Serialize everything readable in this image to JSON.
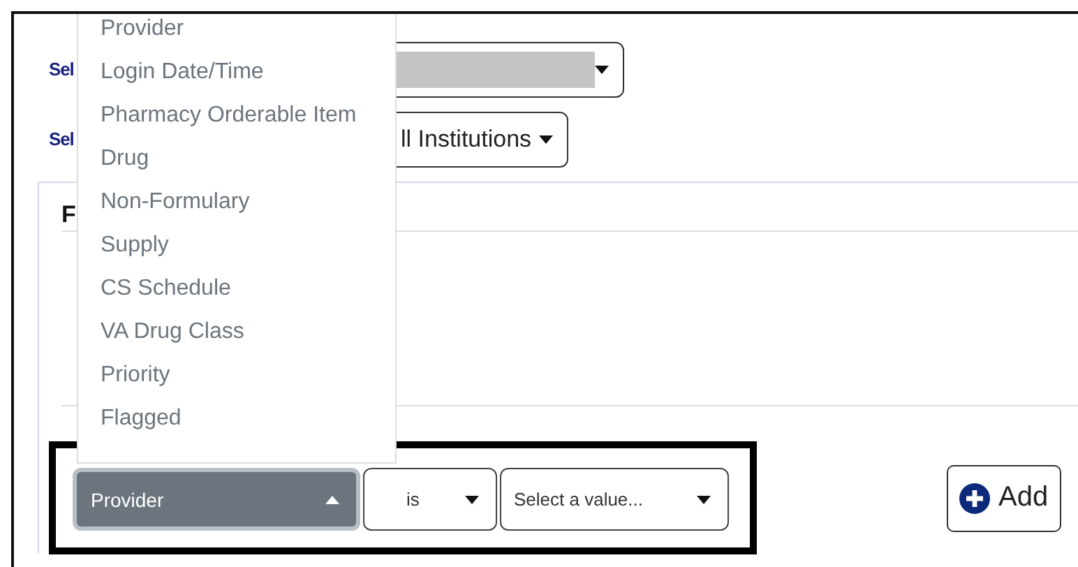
{
  "filters_form": {
    "rows": [
      {
        "label": "Sel",
        "select": {
          "redacted": true
        }
      },
      {
        "label": "Sel",
        "select": {
          "value": "ll Institutions"
        }
      }
    ]
  },
  "panel": {
    "heading": "F",
    "criteria_row": {
      "field_select": {
        "value": "Provider",
        "expanded": true
      },
      "operator_select": {
        "value": "is"
      },
      "value_select": {
        "placeholder": "Select a value..."
      }
    },
    "add_button": {
      "label": "Add"
    }
  },
  "field_menu": {
    "items": [
      {
        "label": "Provider"
      },
      {
        "label": "Login Date/Time"
      },
      {
        "label": "Pharmacy Orderable Item"
      },
      {
        "label": "Drug"
      },
      {
        "label": "Non-Formulary"
      },
      {
        "label": "Supply"
      },
      {
        "label": "CS Schedule"
      },
      {
        "label": "VA Drug Class"
      },
      {
        "label": "Priority"
      },
      {
        "label": "Flagged"
      }
    ]
  }
}
